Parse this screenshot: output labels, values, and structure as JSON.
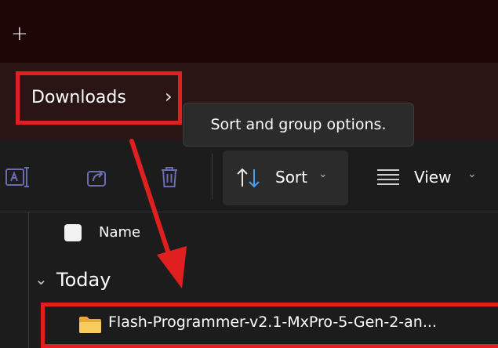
{
  "titlebar": {
    "new_tab": "+"
  },
  "breadcrumb": {
    "label": "Downloads",
    "chevron": "›"
  },
  "tooltip": {
    "text": "Sort and group options."
  },
  "toolbar": {
    "sort_label": "Sort",
    "view_label": "View",
    "dropdown": "⌄"
  },
  "list": {
    "name_header": "Name",
    "group_chevron": "⌄",
    "group_label": "Today",
    "file_name": "Flash-Programmer-v2.1-MxPro-5-Gen-2-an..."
  },
  "colors": {
    "highlight": "#e02020",
    "titlebar": "#1f0606",
    "addressbar": "#2a1414"
  },
  "icons": [
    "rename-icon",
    "share-icon",
    "delete-icon",
    "sort-icon",
    "view-icon",
    "folder-icon"
  ]
}
